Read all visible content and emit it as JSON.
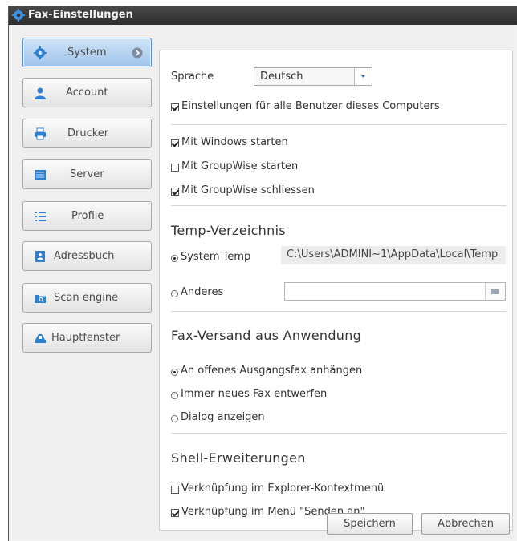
{
  "window": {
    "title": "Fax-Einstellungen",
    "title_icon": "gear-icon"
  },
  "nav": {
    "items": [
      {
        "label": "System",
        "icon": "gear-icon",
        "active": true
      },
      {
        "label": "Account",
        "icon": "user-icon"
      },
      {
        "label": "Drucker",
        "icon": "printer-icon"
      },
      {
        "label": "Server",
        "icon": "server-icon"
      },
      {
        "label": "Profile",
        "icon": "list-icon"
      },
      {
        "label": "Adressbuch",
        "icon": "address-book-icon"
      },
      {
        "label": "Scan engine",
        "icon": "folder-scan-icon"
      },
      {
        "label": "Hauptfenster",
        "icon": "main-window-icon"
      }
    ]
  },
  "system": {
    "language_label": "Sprache",
    "language_value": "Deutsch",
    "all_users": {
      "label": "Einstellungen für alle Benutzer dieses Computers",
      "checked": true
    },
    "start_windows": {
      "label": "Mit Windows starten",
      "checked": true
    },
    "start_groupwise": {
      "label": "Mit GroupWise starten",
      "checked": false
    },
    "close_groupwise": {
      "label": "Mit GroupWise schliessen",
      "checked": true
    },
    "temp": {
      "heading": "Temp-Verzeichnis",
      "system_temp_label": "System Temp",
      "system_temp_path": "C:\\Users\\ADMINI~1\\AppData\\Local\\Temp",
      "other_label": "Anderes",
      "other_value": "",
      "selected": "system"
    },
    "fax_send": {
      "heading": "Fax-Versand aus Anwendung",
      "options": [
        {
          "label": "An offenes Ausgangsfax anhängen",
          "selected": true
        },
        {
          "label": "Immer neues Fax entwerfen",
          "selected": false
        },
        {
          "label": "Dialog anzeigen",
          "selected": false
        }
      ]
    },
    "shell": {
      "heading": "Shell-Erweiterungen",
      "explorer_context": {
        "label": "Verknüpfung im Explorer-Kontextmenü",
        "checked": false
      },
      "send_to": {
        "label": "Verknüpfung im Menü \"Senden an\"",
        "checked": true
      }
    }
  },
  "buttons": {
    "save": "Speichern",
    "cancel": "Abbrechen"
  },
  "colors": {
    "accent": "#2f7fd1",
    "titlebar": "#3a3a3a",
    "active_nav": "#b7d4f2"
  }
}
